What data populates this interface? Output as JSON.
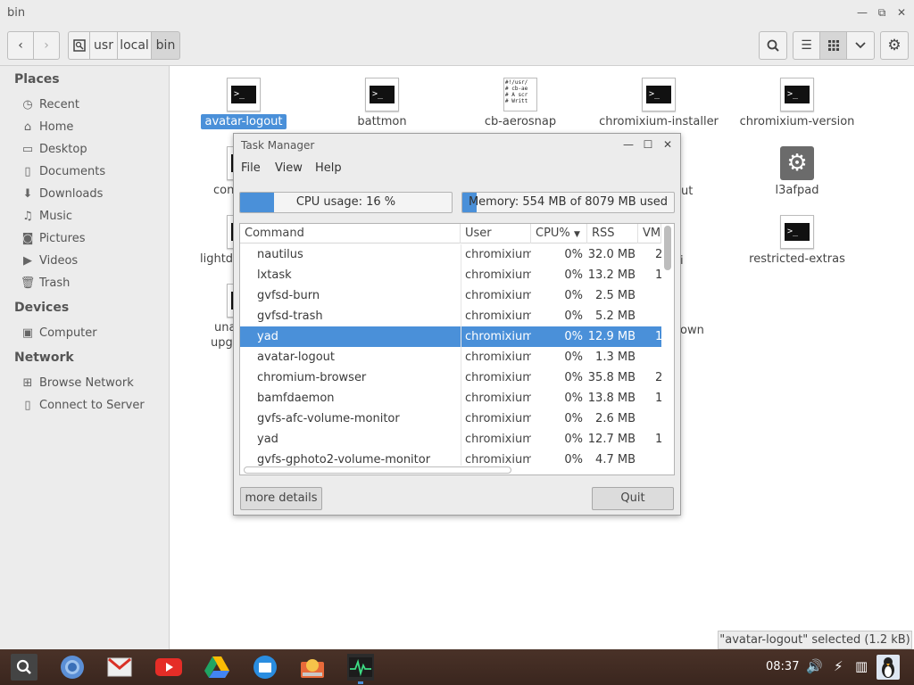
{
  "window": {
    "title": "bin"
  },
  "breadcrumb": [
    "usr",
    "local",
    "bin"
  ],
  "sidebar": {
    "places_head": "Places",
    "places": [
      "Recent",
      "Home",
      "Desktop",
      "Documents",
      "Downloads",
      "Music",
      "Pictures",
      "Videos",
      "Trash"
    ],
    "devices_head": "Devices",
    "devices": [
      "Computer"
    ],
    "network_head": "Network",
    "network": [
      "Browse Network",
      "Connect to Server"
    ]
  },
  "files": [
    {
      "name": "avatar-logout",
      "type": "terminal",
      "selected": true
    },
    {
      "name": "battmon",
      "type": "terminal"
    },
    {
      "name": "cb-aerosnap",
      "type": "script"
    },
    {
      "name": "chromixium-installer",
      "type": "terminal"
    },
    {
      "name": "chromixium-version",
      "type": "terminal"
    },
    {
      "name": "contr",
      "type": "terminal"
    },
    {
      "name": "ut",
      "type": "hidden"
    },
    {
      "name": "l3afpad",
      "type": "gear"
    },
    {
      "name": "lightdm",
      "type": "terminal"
    },
    {
      "name": "i",
      "type": "hidden"
    },
    {
      "name": "restricted-extras",
      "type": "terminal"
    },
    {
      "name": "unat",
      "type": "terminal"
    },
    {
      "name": "upgr",
      "type": "hidden"
    },
    {
      "name": "own",
      "type": "hidden"
    }
  ],
  "script_preview": "#!/usr/\n# cb-ae\n# A scr\n# Writt",
  "statusbar": "\"avatar-logout\" selected  (1.2 kB)",
  "task_manager": {
    "title": "Task Manager",
    "menu": [
      "File",
      "View",
      "Help"
    ],
    "cpu_label": "CPU usage: 16 %",
    "cpu_percent": 16,
    "mem_label": "Memory: 554 MB of 8079 MB used",
    "mem_used_mb": 554,
    "mem_total_mb": 8079,
    "columns": [
      "Command",
      "User",
      "CPU%",
      "RSS",
      "VM"
    ],
    "rows": [
      {
        "command": "nautilus",
        "user": "chromixium",
        "cpu": "0%",
        "rss": "32.0 MB",
        "vm": "2"
      },
      {
        "command": "lxtask",
        "user": "chromixium",
        "cpu": "0%",
        "rss": "13.2 MB",
        "vm": "1"
      },
      {
        "command": "gvfsd-burn",
        "user": "chromixium",
        "cpu": "0%",
        "rss": "2.5 MB",
        "vm": ""
      },
      {
        "command": "gvfsd-trash",
        "user": "chromixium",
        "cpu": "0%",
        "rss": "5.2 MB",
        "vm": ""
      },
      {
        "command": "yad",
        "user": "chromixium",
        "cpu": "0%",
        "rss": "12.9 MB",
        "vm": "1",
        "selected": true
      },
      {
        "command": "avatar-logout",
        "user": "chromixium",
        "cpu": "0%",
        "rss": "1.3 MB",
        "vm": ""
      },
      {
        "command": "chromium-browser",
        "user": "chromixium",
        "cpu": "0%",
        "rss": "35.8 MB",
        "vm": "2"
      },
      {
        "command": "bamfdaemon",
        "user": "chromixium",
        "cpu": "0%",
        "rss": "13.8 MB",
        "vm": "1"
      },
      {
        "command": "gvfs-afc-volume-monitor",
        "user": "chromixium",
        "cpu": "0%",
        "rss": "2.6 MB",
        "vm": ""
      },
      {
        "command": "yad",
        "user": "chromixium",
        "cpu": "0%",
        "rss": "12.7 MB",
        "vm": "1"
      },
      {
        "command": "gvfs-gphoto2-volume-monitor",
        "user": "chromixium",
        "cpu": "0%",
        "rss": "4.7 MB",
        "vm": ""
      }
    ],
    "more_details": "more details",
    "quit": "Quit"
  },
  "taskbar": {
    "apps": [
      "search-app",
      "chromium-app",
      "gmail-app",
      "youtube-app",
      "drive-app",
      "files-app",
      "software-app",
      "task-manager-app"
    ],
    "clock": "08:37"
  },
  "colors": {
    "accent": "#4a90d9",
    "taskbar": "#3a261e"
  }
}
